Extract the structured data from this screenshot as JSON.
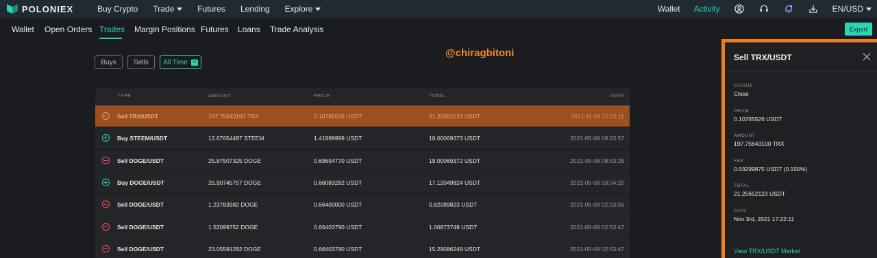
{
  "brand": {
    "name": "POLONIEX"
  },
  "topnav": {
    "items": [
      {
        "label": "Buy Crypto",
        "dropdown": false
      },
      {
        "label": "Trade",
        "dropdown": true
      },
      {
        "label": "Futures",
        "dropdown": false
      },
      {
        "label": "Lending",
        "dropdown": false
      },
      {
        "label": "Explore",
        "dropdown": true
      }
    ],
    "right": {
      "wallet": "Wallet",
      "activity": "Activity",
      "locale": "EN/USD"
    }
  },
  "subnav": {
    "items": [
      "Wallet",
      "Open Orders",
      "Trades",
      "Margin Positions",
      "Futures",
      "Loans",
      "Trade Analysis"
    ],
    "active": "Trades",
    "export_label": "Export"
  },
  "filters": {
    "buys": "Buys",
    "sells": "Sells",
    "all_time": "All Time"
  },
  "watermark": "@chiragbitoni",
  "table": {
    "headers": {
      "type": "TYPE",
      "amount": "AMOUNT",
      "price": "PRICE",
      "total": "TOTAL",
      "date": "DATE"
    },
    "rows": [
      {
        "side": "sell",
        "type": "Sell TRX/USDT",
        "amount": "197.75643100 TRX",
        "price": "0.10765526 USDT",
        "total": "21.25652123 USDT",
        "date": "2021-11-03 17:22:11",
        "highlighted": true
      },
      {
        "side": "buy",
        "type": "Buy STEEM/USDT",
        "amount": "12.67654497 STEEM",
        "price": "1.41999999 USDT",
        "total": "18.00069373 USDT",
        "date": "2021-05-08 08:53:57",
        "highlighted": false
      },
      {
        "side": "sell",
        "type": "Sell DOGE/USDT",
        "amount": "25.87507325 DOGE",
        "price": "0.69654770 USDT",
        "total": "18.00069372 USDT",
        "date": "2021-05-08 08:53:28",
        "highlighted": false
      },
      {
        "side": "buy",
        "type": "Buy DOGE/USDT",
        "amount": "25.90745757 DOGE",
        "price": "0.66083282 USDT",
        "total": "17.12049824 USDT",
        "date": "2021-05-08 03:04:20",
        "highlighted": false
      },
      {
        "side": "sell",
        "type": "Sell DOGE/USDT",
        "amount": "1.23783982 DOGE",
        "price": "0.66400000 USDT",
        "total": "0.82089823 USDT",
        "date": "2021-05-08 02:53:56",
        "highlighted": false
      },
      {
        "side": "sell",
        "type": "Sell DOGE/USDT",
        "amount": "1.52099752 DOGE",
        "price": "0.66403790 USDT",
        "total": "1.00873749 USDT",
        "date": "2021-05-08 02:53:47",
        "highlighted": false
      },
      {
        "side": "sell",
        "type": "Sell DOGE/USDT",
        "amount": "23.05591292 DOGE",
        "price": "0.66403790 USDT",
        "total": "15.29086249 USDT",
        "date": "2021-05-08 02:53:47",
        "highlighted": false
      }
    ]
  },
  "panel": {
    "title": "Sell TRX/USDT",
    "fields": [
      {
        "label": "STATUS",
        "value": "Close"
      },
      {
        "label": "PRICE",
        "value": "0.10765526 USDT"
      },
      {
        "label": "AMOUNT",
        "value": "197.75643100 TRX"
      },
      {
        "label": "FEE",
        "value": "0.03299875 USDT (0.155%)"
      },
      {
        "label": "TOTAL",
        "value": "21.25652123 USDT"
      },
      {
        "label": "DATE",
        "value": "Nov 3rd, 2021 17:22:11"
      }
    ],
    "link": "View TRX/USDT Market"
  },
  "colors": {
    "accent": "#2bd4b6",
    "sell": "#ef5a5a",
    "highlight_row": "#9b4e1e",
    "panel_border": "#f07f22",
    "watermark": "#f08a2f"
  }
}
